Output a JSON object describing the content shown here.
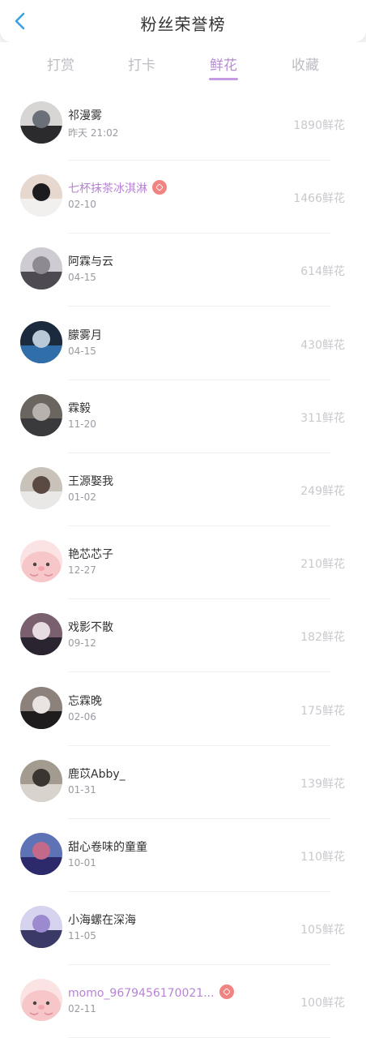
{
  "header": {
    "title": "粉丝荣誉榜",
    "back_icon": "chevron-left-icon"
  },
  "tabs": [
    {
      "label": "打赏",
      "active": false
    },
    {
      "label": "打卡",
      "active": false
    },
    {
      "label": "鲜花",
      "active": true
    },
    {
      "label": "收藏",
      "active": false
    }
  ],
  "colors": {
    "accent": "#b88ad8",
    "badge": "#f08482"
  },
  "fans": [
    {
      "name": "祁漫雾",
      "date": "昨天 21:02",
      "flowers": "1890鲜花",
      "vip": false,
      "avatar": "photo-avatar"
    },
    {
      "name": "七杯抹茶冰淇淋",
      "date": "02-10",
      "flowers": "1466鲜花",
      "vip": true,
      "avatar": "photo-avatar"
    },
    {
      "name": "阿霖与云",
      "date": "04-15",
      "flowers": "614鲜花",
      "vip": false,
      "avatar": "photo-avatar"
    },
    {
      "name": "朦雾月",
      "date": "04-15",
      "flowers": "430鲜花",
      "vip": false,
      "avatar": "photo-avatar"
    },
    {
      "name": "霖毅",
      "date": "11-20",
      "flowers": "311鲜花",
      "vip": false,
      "avatar": "photo-avatar"
    },
    {
      "name": "王源娶我",
      "date": "01-02",
      "flowers": "249鲜花",
      "vip": false,
      "avatar": "photo-avatar"
    },
    {
      "name": "艳芯芯子",
      "date": "12-27",
      "flowers": "210鲜花",
      "vip": false,
      "avatar": "default-seal-avatar"
    },
    {
      "name": "戏影不散",
      "date": "09-12",
      "flowers": "182鲜花",
      "vip": false,
      "avatar": "photo-avatar"
    },
    {
      "name": "忘霖晚",
      "date": "02-06",
      "flowers": "175鲜花",
      "vip": false,
      "avatar": "photo-avatar"
    },
    {
      "name": "鹿苡Abby_",
      "date": "01-31",
      "flowers": "139鲜花",
      "vip": false,
      "avatar": "photo-avatar"
    },
    {
      "name": "甜心卷味的童童",
      "date": "10-01",
      "flowers": "110鲜花",
      "vip": false,
      "avatar": "photo-avatar"
    },
    {
      "name": "小海螺在深海",
      "date": "11-05",
      "flowers": "105鲜花",
      "vip": false,
      "avatar": "photo-avatar"
    },
    {
      "name": "momo_9679456170021...",
      "date": "02-11",
      "flowers": "100鲜花",
      "vip": true,
      "avatar": "default-seal-avatar"
    }
  ]
}
